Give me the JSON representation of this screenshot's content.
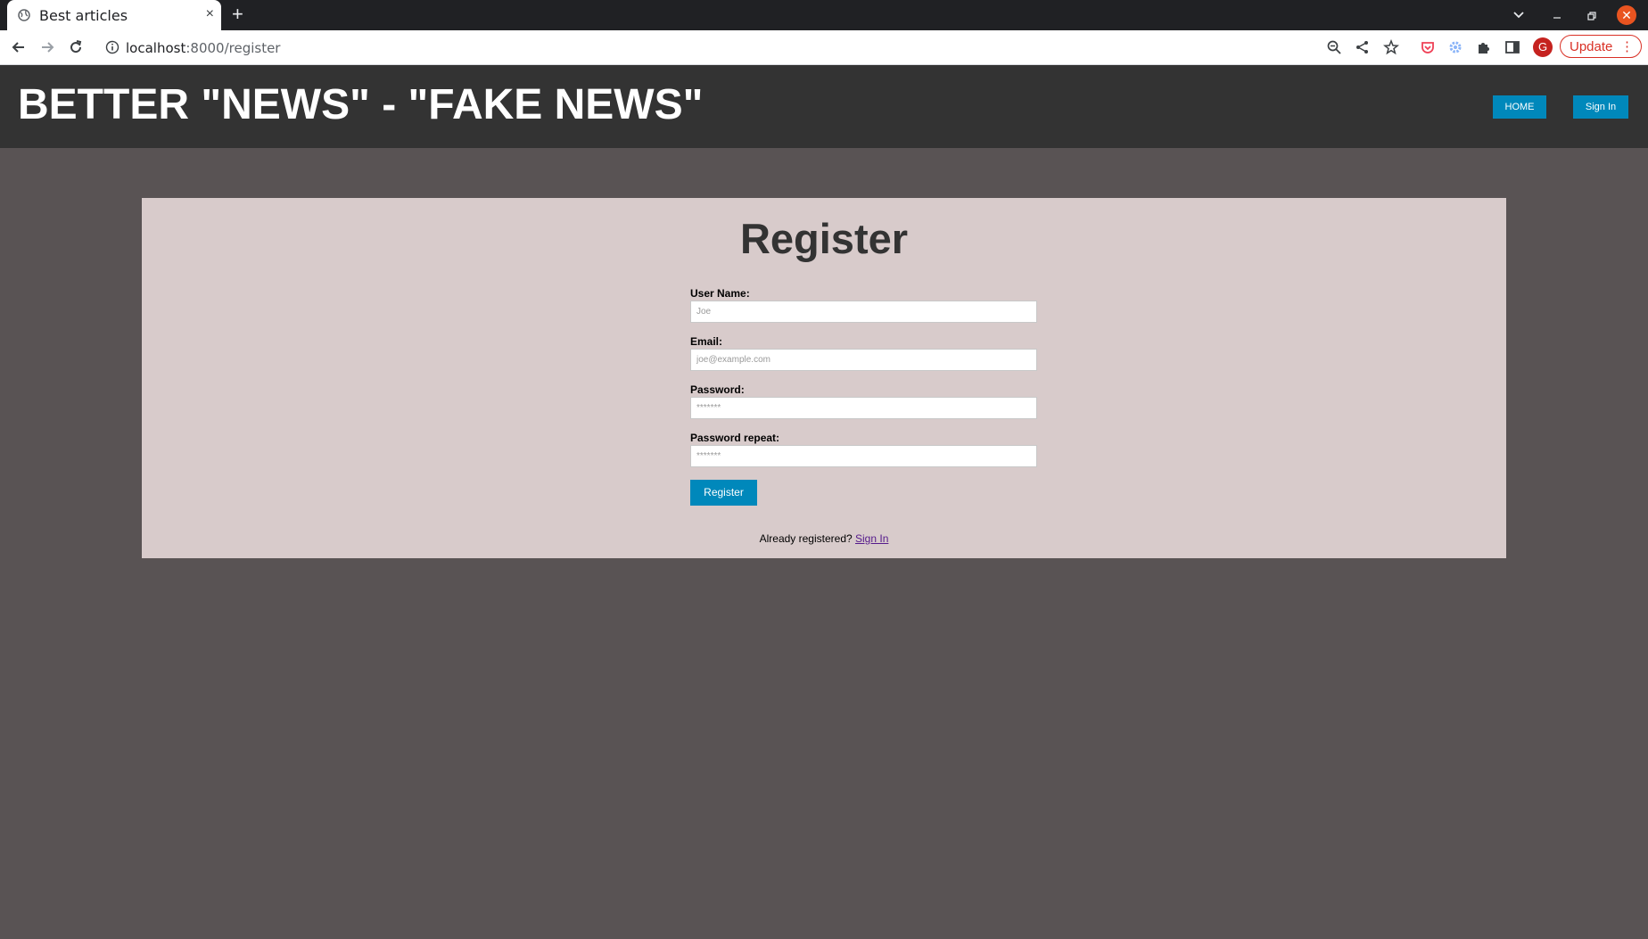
{
  "browser": {
    "tab_title": "Best articles",
    "tab_close": "×",
    "new_tab": "+",
    "url_host": "localhost",
    "url_path": ":8000/register",
    "avatar_letter": "G",
    "update_label": "Update",
    "update_menu": "⋮",
    "close_glyph": "✕"
  },
  "header": {
    "title": "BETTER \"NEWS\" - \"FAKE NEWS\"",
    "home_label": "HOME",
    "signin_label": "Sign In"
  },
  "form": {
    "title": "Register",
    "username_label": "User Name:",
    "username_placeholder": "Joe",
    "email_label": "Email:",
    "email_placeholder": "joe@example.com",
    "password_label": "Password:",
    "password_placeholder": "*******",
    "password_repeat_label": "Password repeat:",
    "password_repeat_placeholder": "*******",
    "submit_label": "Register",
    "footer_text": "Already registered?",
    "footer_link": "Sign In"
  },
  "colors": {
    "page_bg": "#595354",
    "header_bg": "#333333",
    "card_bg": "#d8cbcb",
    "accent": "#0088bb"
  }
}
